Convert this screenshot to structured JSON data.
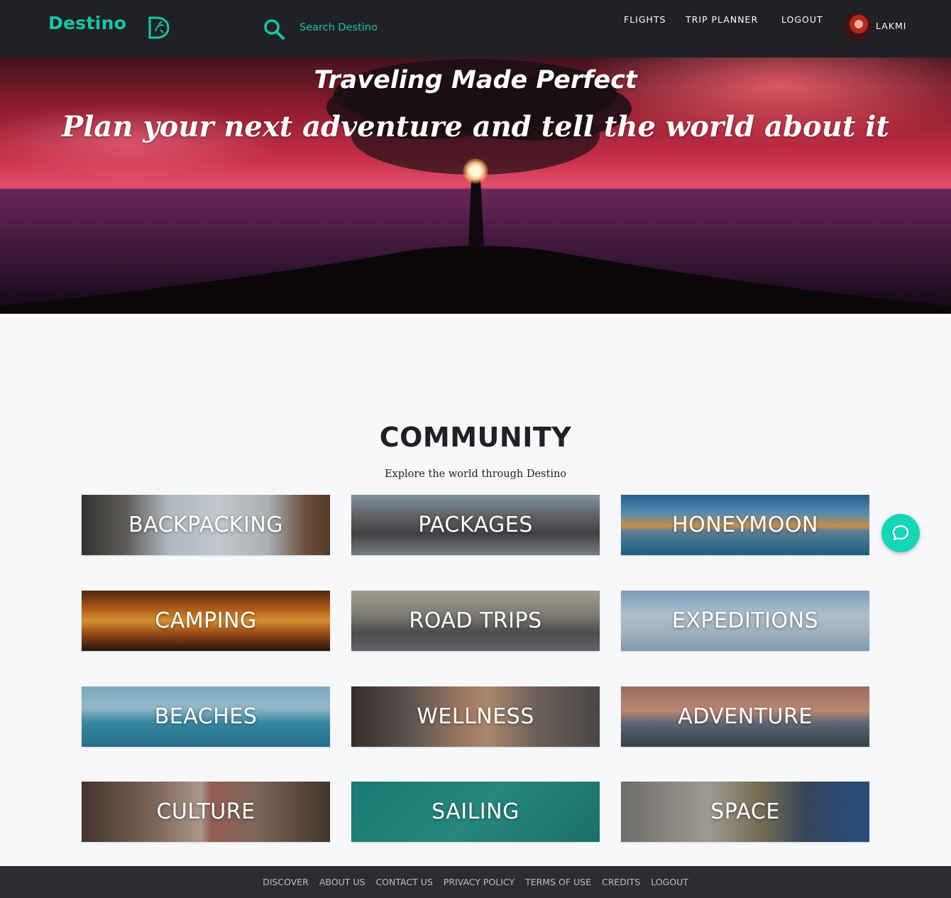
{
  "brand": {
    "name": "Destino",
    "logo_icon": "destino-d-logo-icon",
    "accent_color": "#17c7a5"
  },
  "search": {
    "placeholder": "Search Destino",
    "icon": "search-icon"
  },
  "nav": {
    "flights": "FLIGHTS",
    "trip_planner": "TRIP PLANNER",
    "logout": "LOGOUT"
  },
  "user": {
    "name": "LAKMI"
  },
  "hero": {
    "title": "Traveling Made Perfect",
    "subtitle": "Plan your next adventure and tell the world about it"
  },
  "community": {
    "title": "COMMUNITY",
    "subtitle": "Explore the world through Destino",
    "categories": [
      "BACKPACKING",
      "PACKAGES",
      "HONEYMOON",
      "CAMPING",
      "ROAD TRIPS",
      "EXPEDITIONS",
      "BEACHES",
      "WELLNESS",
      "ADVENTURE",
      "CULTURE",
      "SAILING",
      "SPACE"
    ]
  },
  "chat": {
    "icon": "chat-bubble-icon",
    "color": "#15d6b6"
  },
  "footer": {
    "links": [
      "DISCOVER",
      "ABOUT US",
      "CONTACT US",
      "PRIVACY POLICY",
      "TERMS OF USE",
      "CREDITS",
      "LOGOUT"
    ]
  }
}
